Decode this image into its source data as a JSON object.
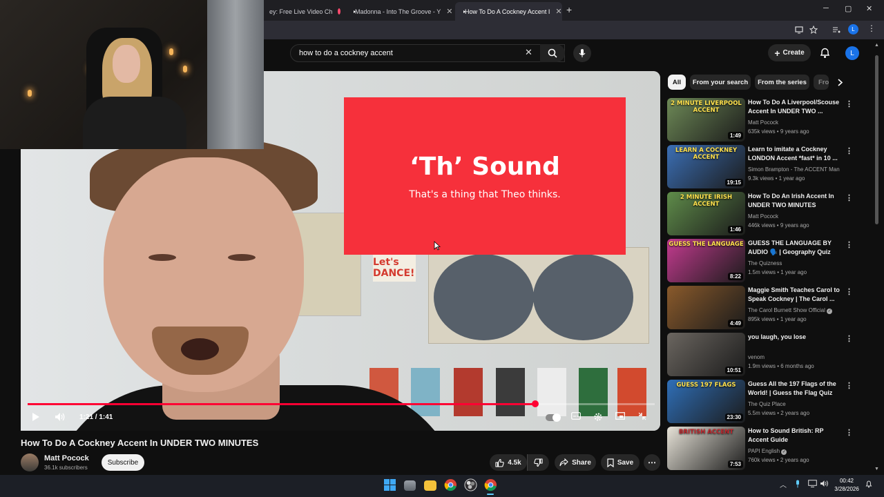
{
  "browser": {
    "tabs": [
      {
        "label": "ey: Free Live Video Ch",
        "recording": true
      },
      {
        "label": "Madonna - Into The Groove - Y"
      },
      {
        "label": "How To Do A Cockney Accent I",
        "active": true
      }
    ],
    "new_tab": "+",
    "window_controls": {
      "minimize": "─",
      "maximize": "▢",
      "close": "✕"
    }
  },
  "youtube": {
    "search": {
      "query": "how to do a cockney accent",
      "clear": "✕"
    },
    "create_label": "Create",
    "avatar_letter": "L",
    "player": {
      "card_title": "‘Th’ Sound",
      "card_subtitle": "That's a thing that Theo thinks.",
      "poster_text": "Let's DANCE!",
      "time": "1:21 / 1:41",
      "progress_fraction": 0.81
    },
    "video": {
      "title": "How To Do A Cockney Accent In UNDER TWO MINUTES",
      "channel": "Matt Pocock",
      "subscribers": "36.1k subscribers",
      "subscribe_label": "Subscribe",
      "likes": "4.5k",
      "share_label": "Share",
      "save_label": "Save"
    },
    "chips": [
      "All",
      "From your search",
      "From the series",
      "Fro"
    ],
    "recommendations": [
      {
        "title": "How To Do A Liverpool/Scouse Accent In UNDER TWO ...",
        "channel": "Matt Pocock",
        "meta": "635k views • 9 years ago",
        "duration": "1:49",
        "thumb_text": "2 MINUTE LIVERPOOL ACCENT",
        "thumb_color": "#6e8a57",
        "verified": false
      },
      {
        "title": "Learn to imitate a Cockney LONDON Accent *fast* in 10 ...",
        "channel": "Simon Brampton - The ACCENT Man",
        "meta": "9.3k views • 1 year ago",
        "duration": "19:15",
        "thumb_text": "LEARN A COCKNEY ACCENT",
        "thumb_color": "#3b6fb5",
        "verified": false
      },
      {
        "title": "How To Do An Irish Accent In UNDER TWO MINUTES",
        "channel": "Matt Pocock",
        "meta": "446k views • 9 years ago",
        "duration": "1:46",
        "thumb_text": "2 MINUTE IRISH ACCENT",
        "thumb_color": "#5f8c4a",
        "verified": false
      },
      {
        "title": "GUESS THE LANGUAGE BY AUDIO 🗣️ | Geography Quiz",
        "channel": "The Quizness",
        "meta": "1.5m views • 1 year ago",
        "duration": "8:22",
        "thumb_text": "GUESS THE LANGUAGE",
        "thumb_color": "#c33b8f",
        "verified": false
      },
      {
        "title": "Maggie Smith Teaches Carol to Speak Cockney | The Carol ...",
        "channel": "The Carol Burnett Show Official",
        "meta": "895k views • 1 year ago",
        "duration": "4:49",
        "thumb_text": "",
        "thumb_color": "#8a5a2b",
        "verified": true
      },
      {
        "title": "you laugh, you lose",
        "channel": "venom",
        "meta": "1.9m views • 6 months ago",
        "duration": "10:51",
        "thumb_text": "",
        "thumb_color": "#6b6660",
        "verified": false
      },
      {
        "title": "Guess All the 197 Flags of the World! | Guess the Flag Quiz",
        "channel": "The Quiz Place",
        "meta": "5.5m views • 2 years ago",
        "duration": "23:30",
        "thumb_text": "GUESS 197 FLAGS",
        "thumb_color": "#2f6fb8",
        "verified": false
      },
      {
        "title": "How to Sound British: RP Accent Guide",
        "channel": "PAPI English",
        "meta": "760k views • 2 years ago",
        "duration": "7:53",
        "thumb_text": "BRITISH ACCENT",
        "thumb_color": "#e7e3d8",
        "verified": true
      }
    ]
  },
  "taskbar": {
    "time": "00:42",
    "date": "3/28/2026"
  },
  "colors": {
    "accent": "#ff0033",
    "background": "#0f0f0f",
    "card_red": "#f6303b"
  }
}
